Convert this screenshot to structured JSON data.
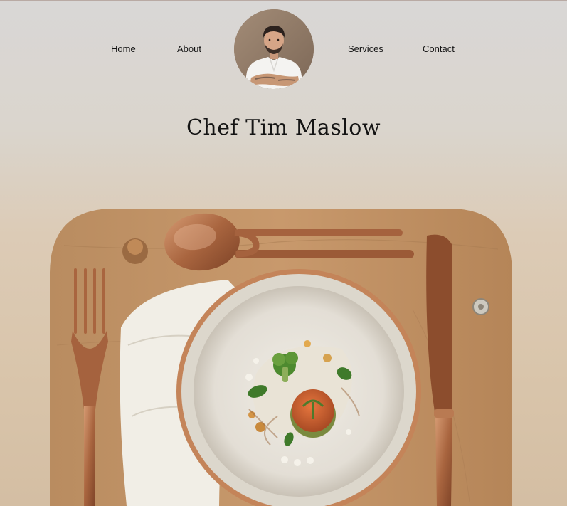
{
  "nav": {
    "home": "Home",
    "about": "About",
    "services": "Services",
    "contact": "Contact"
  },
  "profile": {
    "name": "Chef Tim Maslow"
  },
  "icons": {
    "avatar": "chef-portrait",
    "hero": "plated-dish-on-wooden-tray"
  },
  "colors": {
    "background_top": "#d9d7d6",
    "background_bottom": "#d4bea3",
    "text": "#151515",
    "copper": "#b77750",
    "wood": "#bf9166"
  }
}
